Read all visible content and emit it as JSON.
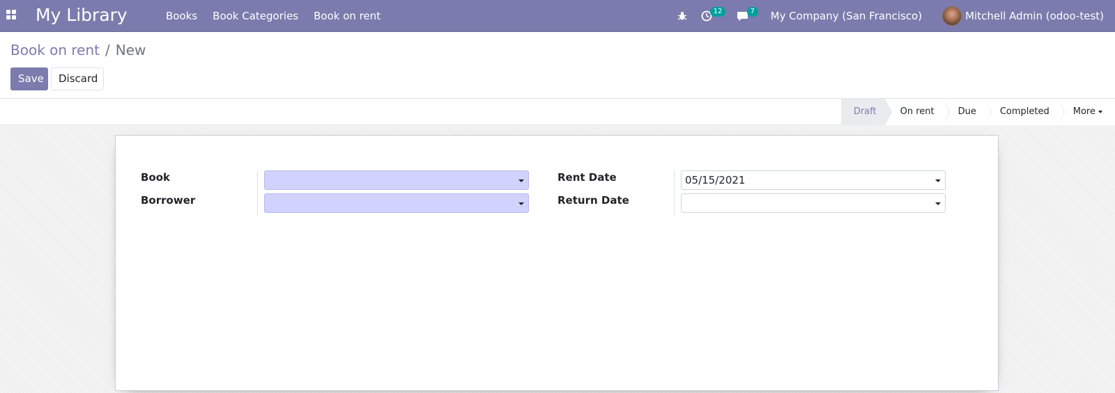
{
  "navbar": {
    "app_title": "My Library",
    "menu": [
      "Books",
      "Book Categories",
      "Book on rent"
    ],
    "activity_count": "12",
    "message_count": "7",
    "company": "My Company (San Francisco)",
    "user": "Mitchell Admin (odoo-test)"
  },
  "breadcrumb": {
    "parent": "Book on rent",
    "separator": "/",
    "current": "New"
  },
  "buttons": {
    "save": "Save",
    "discard": "Discard"
  },
  "statusbar": {
    "steps": [
      "Draft",
      "On rent",
      "Due",
      "Completed"
    ],
    "active_step": "Draft",
    "more": "More"
  },
  "form": {
    "book_label": "Book",
    "book_value": "",
    "borrower_label": "Borrower",
    "borrower_value": "",
    "rent_date_label": "Rent Date",
    "rent_date_value": "05/15/2021",
    "return_date_label": "Return Date",
    "return_date_value": ""
  },
  "colors": {
    "brand": "#7c7bad",
    "badge": "#00a09d",
    "required_field": "#d2d2ff"
  }
}
